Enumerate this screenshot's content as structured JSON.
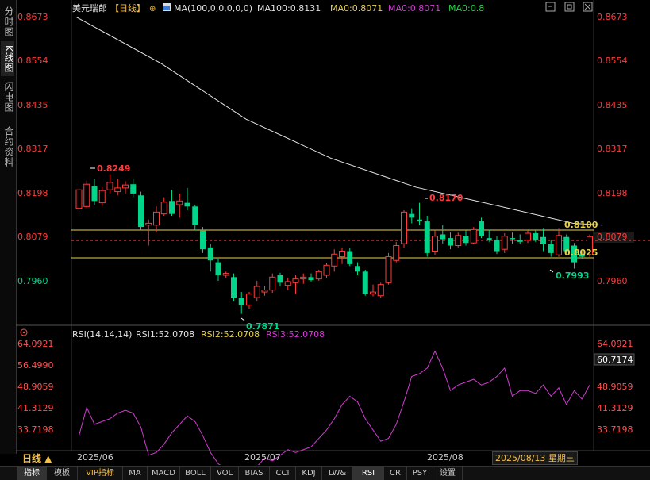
{
  "side_tabs": [
    {
      "label": "分时图",
      "active": false
    },
    {
      "label": "K线图",
      "active": true
    },
    {
      "label": "闪电图",
      "active": false
    },
    {
      "label": "合约资料",
      "active": false
    }
  ],
  "header": {
    "symbol": "美元瑞郎",
    "period": "【日线】",
    "ma_params": "MA(100,0,0,0,0,0)",
    "ma100": "MA100:0.8131",
    "ma0_a": "MA0:0.8071",
    "ma0_b": "MA0:0.8071",
    "ma0_c": "MA0:0.8"
  },
  "rsi_header": {
    "params": "RSI(14,14,14)",
    "rsi1": "RSI1:52.0708",
    "rsi2": "RSI2:52.0708",
    "rsi3": "RSI3:52.0708"
  },
  "price_axis": {
    "left_ticks": [
      "0.8673",
      "0.8554",
      "0.8435",
      "0.8317",
      "0.8198",
      "0.8079",
      "0.7960"
    ],
    "right_ticks": [
      "0.8673",
      "0.8554",
      "0.8435",
      "0.8317",
      "0.8198",
      "0.8079",
      "0.7960"
    ],
    "current": "0.8079"
  },
  "rsi_axis": {
    "ticks": [
      "64.0921",
      "56.4990",
      "48.9059",
      "41.3129",
      "33.7198"
    ],
    "current": "60.7174"
  },
  "annotations": {
    "high1": "0.8249",
    "high2": "0.8170",
    "low1": "0.7871",
    "low2": "0.7993",
    "level_upper": "0.8100",
    "level_lower": "0.8025"
  },
  "dates": {
    "d1": "2025/06",
    "d2": "2025/07",
    "d3": "2025/08",
    "current": "2025/08/13 星期三",
    "period_btn": "日线 ▲"
  },
  "bottom_tabs": [
    {
      "label": "指标",
      "active": true
    },
    {
      "label": "模板"
    },
    {
      "label": "VIP指标",
      "vip": true
    },
    {
      "label": "MA"
    },
    {
      "label": "MACD"
    },
    {
      "label": "BOLL"
    },
    {
      "label": "VOL"
    },
    {
      "label": "BIAS"
    },
    {
      "label": "CCI"
    },
    {
      "label": "KDJ"
    },
    {
      "label": "LW&"
    },
    {
      "label": "RSI",
      "active": true
    },
    {
      "label": "CR"
    },
    {
      "label": "PSY"
    },
    {
      "label": "设置"
    }
  ],
  "colors": {
    "up": "#ff3b3b",
    "down": "#00d58a",
    "ma100": "#e6e6e6",
    "level": "#e8d24a",
    "rsi": "#d23cd2",
    "price_text": "#ff3b3b",
    "rsi_text": "#ff5050"
  },
  "chart_data": {
    "type": "candlestick",
    "title": "美元瑞郎【日线】",
    "price_range": [
      0.7855,
      0.868
    ],
    "candles": [
      {
        "o": 0.8155,
        "h": 0.8215,
        "l": 0.815,
        "c": 0.8205
      },
      {
        "o": 0.816,
        "h": 0.823,
        "l": 0.8155,
        "c": 0.822
      },
      {
        "o": 0.8215,
        "h": 0.8235,
        "l": 0.8165,
        "c": 0.8175
      },
      {
        "o": 0.817,
        "h": 0.8212,
        "l": 0.8162,
        "c": 0.8203
      },
      {
        "o": 0.8205,
        "h": 0.8249,
        "l": 0.8195,
        "c": 0.8225
      },
      {
        "o": 0.82,
        "h": 0.8235,
        "l": 0.819,
        "c": 0.821
      },
      {
        "o": 0.821,
        "h": 0.8228,
        "l": 0.8195,
        "c": 0.8218
      },
      {
        "o": 0.822,
        "h": 0.8235,
        "l": 0.8185,
        "c": 0.8195
      },
      {
        "o": 0.819,
        "h": 0.82,
        "l": 0.8095,
        "c": 0.8105
      },
      {
        "o": 0.811,
        "h": 0.8125,
        "l": 0.8055,
        "c": 0.8115
      },
      {
        "o": 0.811,
        "h": 0.816,
        "l": 0.809,
        "c": 0.8145
      },
      {
        "o": 0.814,
        "h": 0.8185,
        "l": 0.8135,
        "c": 0.8172
      },
      {
        "o": 0.8175,
        "h": 0.8205,
        "l": 0.8135,
        "c": 0.814
      },
      {
        "o": 0.8165,
        "h": 0.8195,
        "l": 0.813,
        "c": 0.8175
      },
      {
        "o": 0.817,
        "h": 0.821,
        "l": 0.815,
        "c": 0.816
      },
      {
        "o": 0.816,
        "h": 0.8165,
        "l": 0.8095,
        "c": 0.811
      },
      {
        "o": 0.8095,
        "h": 0.8105,
        "l": 0.8035,
        "c": 0.8045
      },
      {
        "o": 0.805,
        "h": 0.806,
        "l": 0.7985,
        "c": 0.8015
      },
      {
        "o": 0.801,
        "h": 0.802,
        "l": 0.796,
        "c": 0.7975
      },
      {
        "o": 0.7975,
        "h": 0.7985,
        "l": 0.7968,
        "c": 0.798
      },
      {
        "o": 0.797,
        "h": 0.798,
        "l": 0.7905,
        "c": 0.7915
      },
      {
        "o": 0.7915,
        "h": 0.793,
        "l": 0.7871,
        "c": 0.7895
      },
      {
        "o": 0.7895,
        "h": 0.793,
        "l": 0.7885,
        "c": 0.7925
      },
      {
        "o": 0.7915,
        "h": 0.796,
        "l": 0.7905,
        "c": 0.7945
      },
      {
        "o": 0.793,
        "h": 0.7945,
        "l": 0.792,
        "c": 0.7935
      },
      {
        "o": 0.7935,
        "h": 0.798,
        "l": 0.7928,
        "c": 0.797
      },
      {
        "o": 0.7975,
        "h": 0.7982,
        "l": 0.7945,
        "c": 0.7955
      },
      {
        "o": 0.7948,
        "h": 0.7968,
        "l": 0.7935,
        "c": 0.7958
      },
      {
        "o": 0.7955,
        "h": 0.7975,
        "l": 0.7925,
        "c": 0.7965
      },
      {
        "o": 0.7965,
        "h": 0.798,
        "l": 0.7952,
        "c": 0.797
      },
      {
        "o": 0.797,
        "h": 0.798,
        "l": 0.7958,
        "c": 0.7962
      },
      {
        "o": 0.7965,
        "h": 0.799,
        "l": 0.796,
        "c": 0.7985
      },
      {
        "o": 0.7975,
        "h": 0.8008,
        "l": 0.7968,
        "c": 0.8002
      },
      {
        "o": 0.8,
        "h": 0.8045,
        "l": 0.7985,
        "c": 0.8032
      },
      {
        "o": 0.8025,
        "h": 0.805,
        "l": 0.8005,
        "c": 0.804
      },
      {
        "o": 0.804,
        "h": 0.8048,
        "l": 0.8,
        "c": 0.8005
      },
      {
        "o": 0.8,
        "h": 0.801,
        "l": 0.7975,
        "c": 0.7985
      },
      {
        "o": 0.7985,
        "h": 0.799,
        "l": 0.792,
        "c": 0.7925
      },
      {
        "o": 0.7925,
        "h": 0.795,
        "l": 0.7918,
        "c": 0.793
      },
      {
        "o": 0.792,
        "h": 0.7955,
        "l": 0.7915,
        "c": 0.795
      },
      {
        "o": 0.7955,
        "h": 0.8035,
        "l": 0.795,
        "c": 0.8025
      },
      {
        "o": 0.8015,
        "h": 0.8065,
        "l": 0.801,
        "c": 0.8055
      },
      {
        "o": 0.806,
        "h": 0.815,
        "l": 0.805,
        "c": 0.8145
      },
      {
        "o": 0.814,
        "h": 0.8155,
        "l": 0.8115,
        "c": 0.813
      },
      {
        "o": 0.8125,
        "h": 0.817,
        "l": 0.811,
        "c": 0.812
      },
      {
        "o": 0.812,
        "h": 0.8135,
        "l": 0.8025,
        "c": 0.8035
      },
      {
        "o": 0.804,
        "h": 0.8095,
        "l": 0.803,
        "c": 0.808
      },
      {
        "o": 0.8085,
        "h": 0.811,
        "l": 0.806,
        "c": 0.8072
      },
      {
        "o": 0.8075,
        "h": 0.809,
        "l": 0.8045,
        "c": 0.8055
      },
      {
        "o": 0.8055,
        "h": 0.809,
        "l": 0.805,
        "c": 0.8082
      },
      {
        "o": 0.808,
        "h": 0.8095,
        "l": 0.8055,
        "c": 0.8062
      },
      {
        "o": 0.8062,
        "h": 0.8105,
        "l": 0.8058,
        "c": 0.8098
      },
      {
        "o": 0.812,
        "h": 0.813,
        "l": 0.8075,
        "c": 0.808
      },
      {
        "o": 0.8075,
        "h": 0.8098,
        "l": 0.8065,
        "c": 0.807
      },
      {
        "o": 0.807,
        "h": 0.808,
        "l": 0.8032,
        "c": 0.804
      },
      {
        "o": 0.8045,
        "h": 0.8088,
        "l": 0.8035,
        "c": 0.808
      },
      {
        "o": 0.8075,
        "h": 0.809,
        "l": 0.806,
        "c": 0.8072
      },
      {
        "o": 0.807,
        "h": 0.8085,
        "l": 0.8058,
        "c": 0.8065
      },
      {
        "o": 0.807,
        "h": 0.8095,
        "l": 0.8062,
        "c": 0.8088
      },
      {
        "o": 0.8088,
        "h": 0.8095,
        "l": 0.8065,
        "c": 0.807
      },
      {
        "o": 0.8078,
        "h": 0.81,
        "l": 0.804,
        "c": 0.806
      },
      {
        "o": 0.806,
        "h": 0.807,
        "l": 0.8025,
        "c": 0.8035
      },
      {
        "o": 0.803,
        "h": 0.81,
        "l": 0.8025,
        "c": 0.8082
      },
      {
        "o": 0.8078,
        "h": 0.8085,
        "l": 0.8035,
        "c": 0.804
      },
      {
        "o": 0.8055,
        "h": 0.8062,
        "l": 0.7993,
        "c": 0.801
      },
      {
        "o": 0.8032,
        "h": 0.804,
        "l": 0.802,
        "c": 0.8025
      },
      {
        "o": 0.803,
        "h": 0.8085,
        "l": 0.8025,
        "c": 0.8079
      }
    ],
    "ma100": [
      [
        0,
        0.867
      ],
      [
        20,
        0.8545
      ],
      [
        40,
        0.8395
      ],
      [
        60,
        0.829
      ],
      [
        80,
        0.8212
      ],
      [
        100,
        0.816
      ],
      [
        117,
        0.8115
      ],
      [
        124,
        0.811
      ]
    ],
    "rsi": [
      34,
      44,
      38,
      39,
      40,
      42,
      43,
      42,
      37,
      27,
      28,
      31,
      35,
      38,
      41,
      39,
      34,
      28,
      24,
      22,
      21,
      17,
      18,
      23,
      26,
      25,
      27,
      29,
      28,
      29,
      30,
      33,
      36,
      40,
      45,
      48,
      46,
      40,
      36,
      32,
      33,
      38,
      46,
      55,
      56,
      58,
      64,
      58,
      50,
      52,
      53,
      54,
      52,
      53,
      55,
      58,
      48,
      50,
      50,
      49,
      52,
      48,
      51,
      45,
      50,
      47,
      52
    ],
    "rsi_range": [
      29.5,
      67
    ]
  }
}
